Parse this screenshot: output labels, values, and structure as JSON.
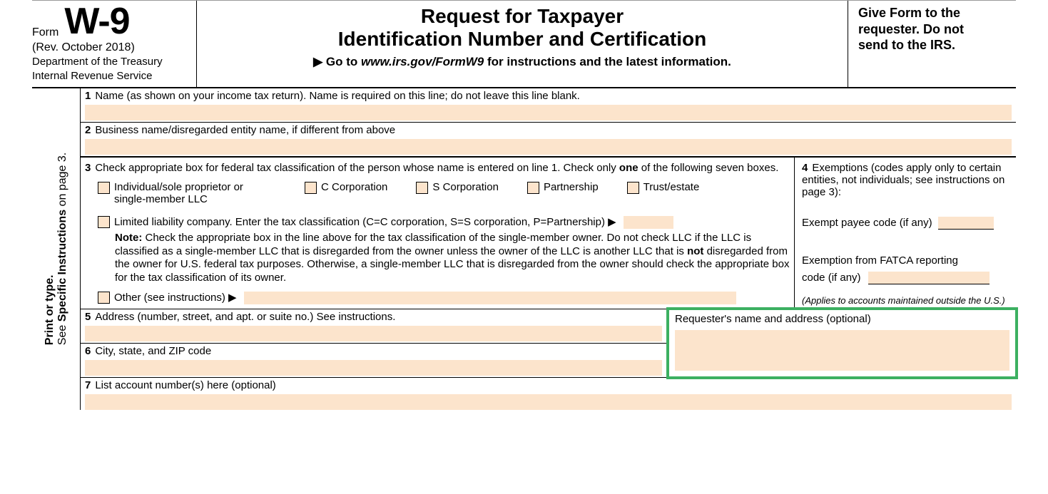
{
  "header": {
    "form_word": "Form",
    "form_code": "W-9",
    "revision": "(Rev. October 2018)",
    "dept_line1": "Department of the Treasury",
    "dept_line2": "Internal Revenue Service",
    "title_line1": "Request for Taxpayer",
    "title_line2": "Identification Number and Certification",
    "goto_prefix": "▶ Go to ",
    "goto_url": "www.irs.gov/FormW9",
    "goto_suffix": " for instructions and the latest information.",
    "give_line1": "Give Form to the",
    "give_line2": "requester. Do not",
    "give_line3": "send to the IRS."
  },
  "sidebar": {
    "line1_bold": "Print or type.",
    "line2_a": "See ",
    "line2_bold": "Specific Instructions",
    "line2_b": " on page 3."
  },
  "r1": {
    "num": "1",
    "label": "Name (as shown on your income tax return). Name is required on this line; do not leave this line blank."
  },
  "r2": {
    "num": "2",
    "label": "Business name/disregarded entity name, if different from above"
  },
  "r3": {
    "num": "3",
    "intro_a": "Check appropriate box for federal tax classification of the person whose name is entered on line 1. Check only ",
    "intro_bold": "one",
    "intro_b": " of the following seven boxes.",
    "opt_individual_a": "Individual/sole proprietor or",
    "opt_individual_b": "single-member LLC",
    "opt_ccorp": "C Corporation",
    "opt_scorp": "S Corporation",
    "opt_partnership": "Partnership",
    "opt_trust": "Trust/estate",
    "opt_llc": "Limited liability company. Enter the tax classification (C=C corporation, S=S corporation, P=Partnership) ▶",
    "note_bold": "Note:",
    "note_a": " Check the appropriate box in the line above for the tax classification of the single-member owner.  Do not check LLC if the LLC is classified as a single-member LLC that is disregarded from the owner unless the owner of the LLC is another LLC that is ",
    "note_bold2": "not",
    "note_b": " disregarded from the owner for U.S. federal tax purposes. Otherwise, a single-member LLC that is disregarded from the owner should check the appropriate box for the tax classification of its owner.",
    "opt_other": "Other (see instructions) ▶"
  },
  "r4": {
    "num": "4",
    "intro": "Exemptions (codes apply only to certain entities, not individuals; see instructions on page 3):",
    "payee": "Exempt payee code (if any)",
    "fatca_a": "Exemption from FATCA reporting",
    "fatca_b": "code (if any)",
    "applies": "(Applies to accounts maintained outside the U.S.)"
  },
  "r5": {
    "num": "5",
    "label": "Address (number, street, and apt. or suite no.) See instructions."
  },
  "r6": {
    "num": "6",
    "label": "City, state, and ZIP code"
  },
  "requester": {
    "label": "Requester's name and address (optional)"
  },
  "r7": {
    "num": "7",
    "label": "List account number(s) here (optional)"
  }
}
